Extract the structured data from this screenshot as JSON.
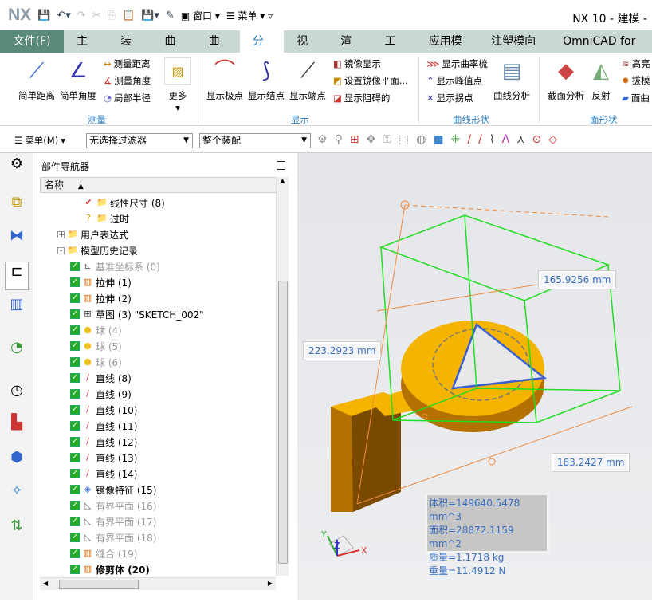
{
  "app": {
    "logo": "NX",
    "title": "NX 10 - 建模 -",
    "quick_access": [
      "窗口",
      "菜单"
    ]
  },
  "tabs": [
    "文件(F)",
    "主页",
    "装配",
    "曲线",
    "曲面",
    "分析",
    "视图",
    "渲染",
    "工具",
    "应用模块",
    "注塑模向导",
    "OmniCAD for NX"
  ],
  "active_tab": "分析",
  "ribbon": {
    "measure": {
      "label": "测量",
      "big": [
        "简单距离",
        "简单角度"
      ],
      "small": [
        "测量距离",
        "测量角度",
        "局部半径"
      ],
      "more": "更多"
    },
    "display": {
      "label": "显示",
      "big": [
        "显示极点",
        "显示结点",
        "显示端点"
      ],
      "small": [
        "镜像显示",
        "设置镜像平面...",
        "显示阻碍的"
      ]
    },
    "curve_shape": {
      "label": "曲线形状",
      "small": [
        "显示曲率梳",
        "显示峰值点",
        "显示拐点"
      ],
      "big": "曲线分析"
    },
    "face_shape": {
      "label": "面形状",
      "big": [
        "截面分析",
        "反射"
      ],
      "small": [
        "高亮",
        "拔模",
        "面曲"
      ]
    }
  },
  "toolbar2": {
    "menu": "菜单(M)",
    "filter": "无选择过滤器",
    "scope": "整个装配"
  },
  "navigator": {
    "title": "部件导航器",
    "column": "名称",
    "rows": [
      {
        "label": "线性尺寸 (8)",
        "indent": 3,
        "icon": "✔",
        "style": ""
      },
      {
        "label": "过时",
        "indent": 3,
        "icon": "?",
        "style": ""
      },
      {
        "label": "用户表达式",
        "indent": 1,
        "icon": "+",
        "style": ""
      },
      {
        "label": "模型历史记录",
        "indent": 1,
        "icon": "-",
        "style": ""
      },
      {
        "label": "基准坐标系 (0)",
        "indent": 2,
        "icon": "⊾",
        "style": "grey"
      },
      {
        "label": "拉伸 (1)",
        "indent": 2,
        "icon": "▥",
        "style": ""
      },
      {
        "label": "拉伸 (2)",
        "indent": 2,
        "icon": "▥",
        "style": ""
      },
      {
        "label": "草图 (3) \"SKETCH_002\"",
        "indent": 2,
        "icon": "⊞",
        "style": ""
      },
      {
        "label": "球 (4)",
        "indent": 2,
        "icon": "●",
        "style": "grey"
      },
      {
        "label": "球 (5)",
        "indent": 2,
        "icon": "●",
        "style": "grey"
      },
      {
        "label": "球 (6)",
        "indent": 2,
        "icon": "●",
        "style": "grey"
      },
      {
        "label": "直线 (8)",
        "indent": 2,
        "icon": "/",
        "style": ""
      },
      {
        "label": "直线 (9)",
        "indent": 2,
        "icon": "/",
        "style": ""
      },
      {
        "label": "直线 (10)",
        "indent": 2,
        "icon": "/",
        "style": ""
      },
      {
        "label": "直线 (11)",
        "indent": 2,
        "icon": "/",
        "style": ""
      },
      {
        "label": "直线 (12)",
        "indent": 2,
        "icon": "/",
        "style": ""
      },
      {
        "label": "直线 (13)",
        "indent": 2,
        "icon": "/",
        "style": ""
      },
      {
        "label": "直线 (14)",
        "indent": 2,
        "icon": "/",
        "style": ""
      },
      {
        "label": "镜像特征 (15)",
        "indent": 2,
        "icon": "◈",
        "style": ""
      },
      {
        "label": "有界平面 (16)",
        "indent": 2,
        "icon": "◺",
        "style": "grey"
      },
      {
        "label": "有界平面 (17)",
        "indent": 2,
        "icon": "◺",
        "style": "grey"
      },
      {
        "label": "有界平面 (18)",
        "indent": 2,
        "icon": "◺",
        "style": "grey"
      },
      {
        "label": "缝合 (19)",
        "indent": 2,
        "icon": "▥",
        "style": "grey"
      },
      {
        "label": "修剪体 (20)",
        "indent": 2,
        "icon": "▥",
        "style": "bold"
      }
    ]
  },
  "viewport": {
    "dimensions": [
      "165.9256 mm",
      "223.2923 mm",
      "183.2427 mm"
    ],
    "info": [
      "体积=149640.5478 mm^3",
      "面积=28872.1159 mm^2",
      "质量=1.1718 kg",
      "重量=11.4912 N"
    ],
    "axes": [
      "X",
      "Y",
      "Z"
    ]
  },
  "colors": {
    "accent": "#2a7cc0",
    "file_tab": "#5a8a7c",
    "model": "#f5b400",
    "bbox": "#22dd22",
    "dim_line": "#f08a3c"
  }
}
